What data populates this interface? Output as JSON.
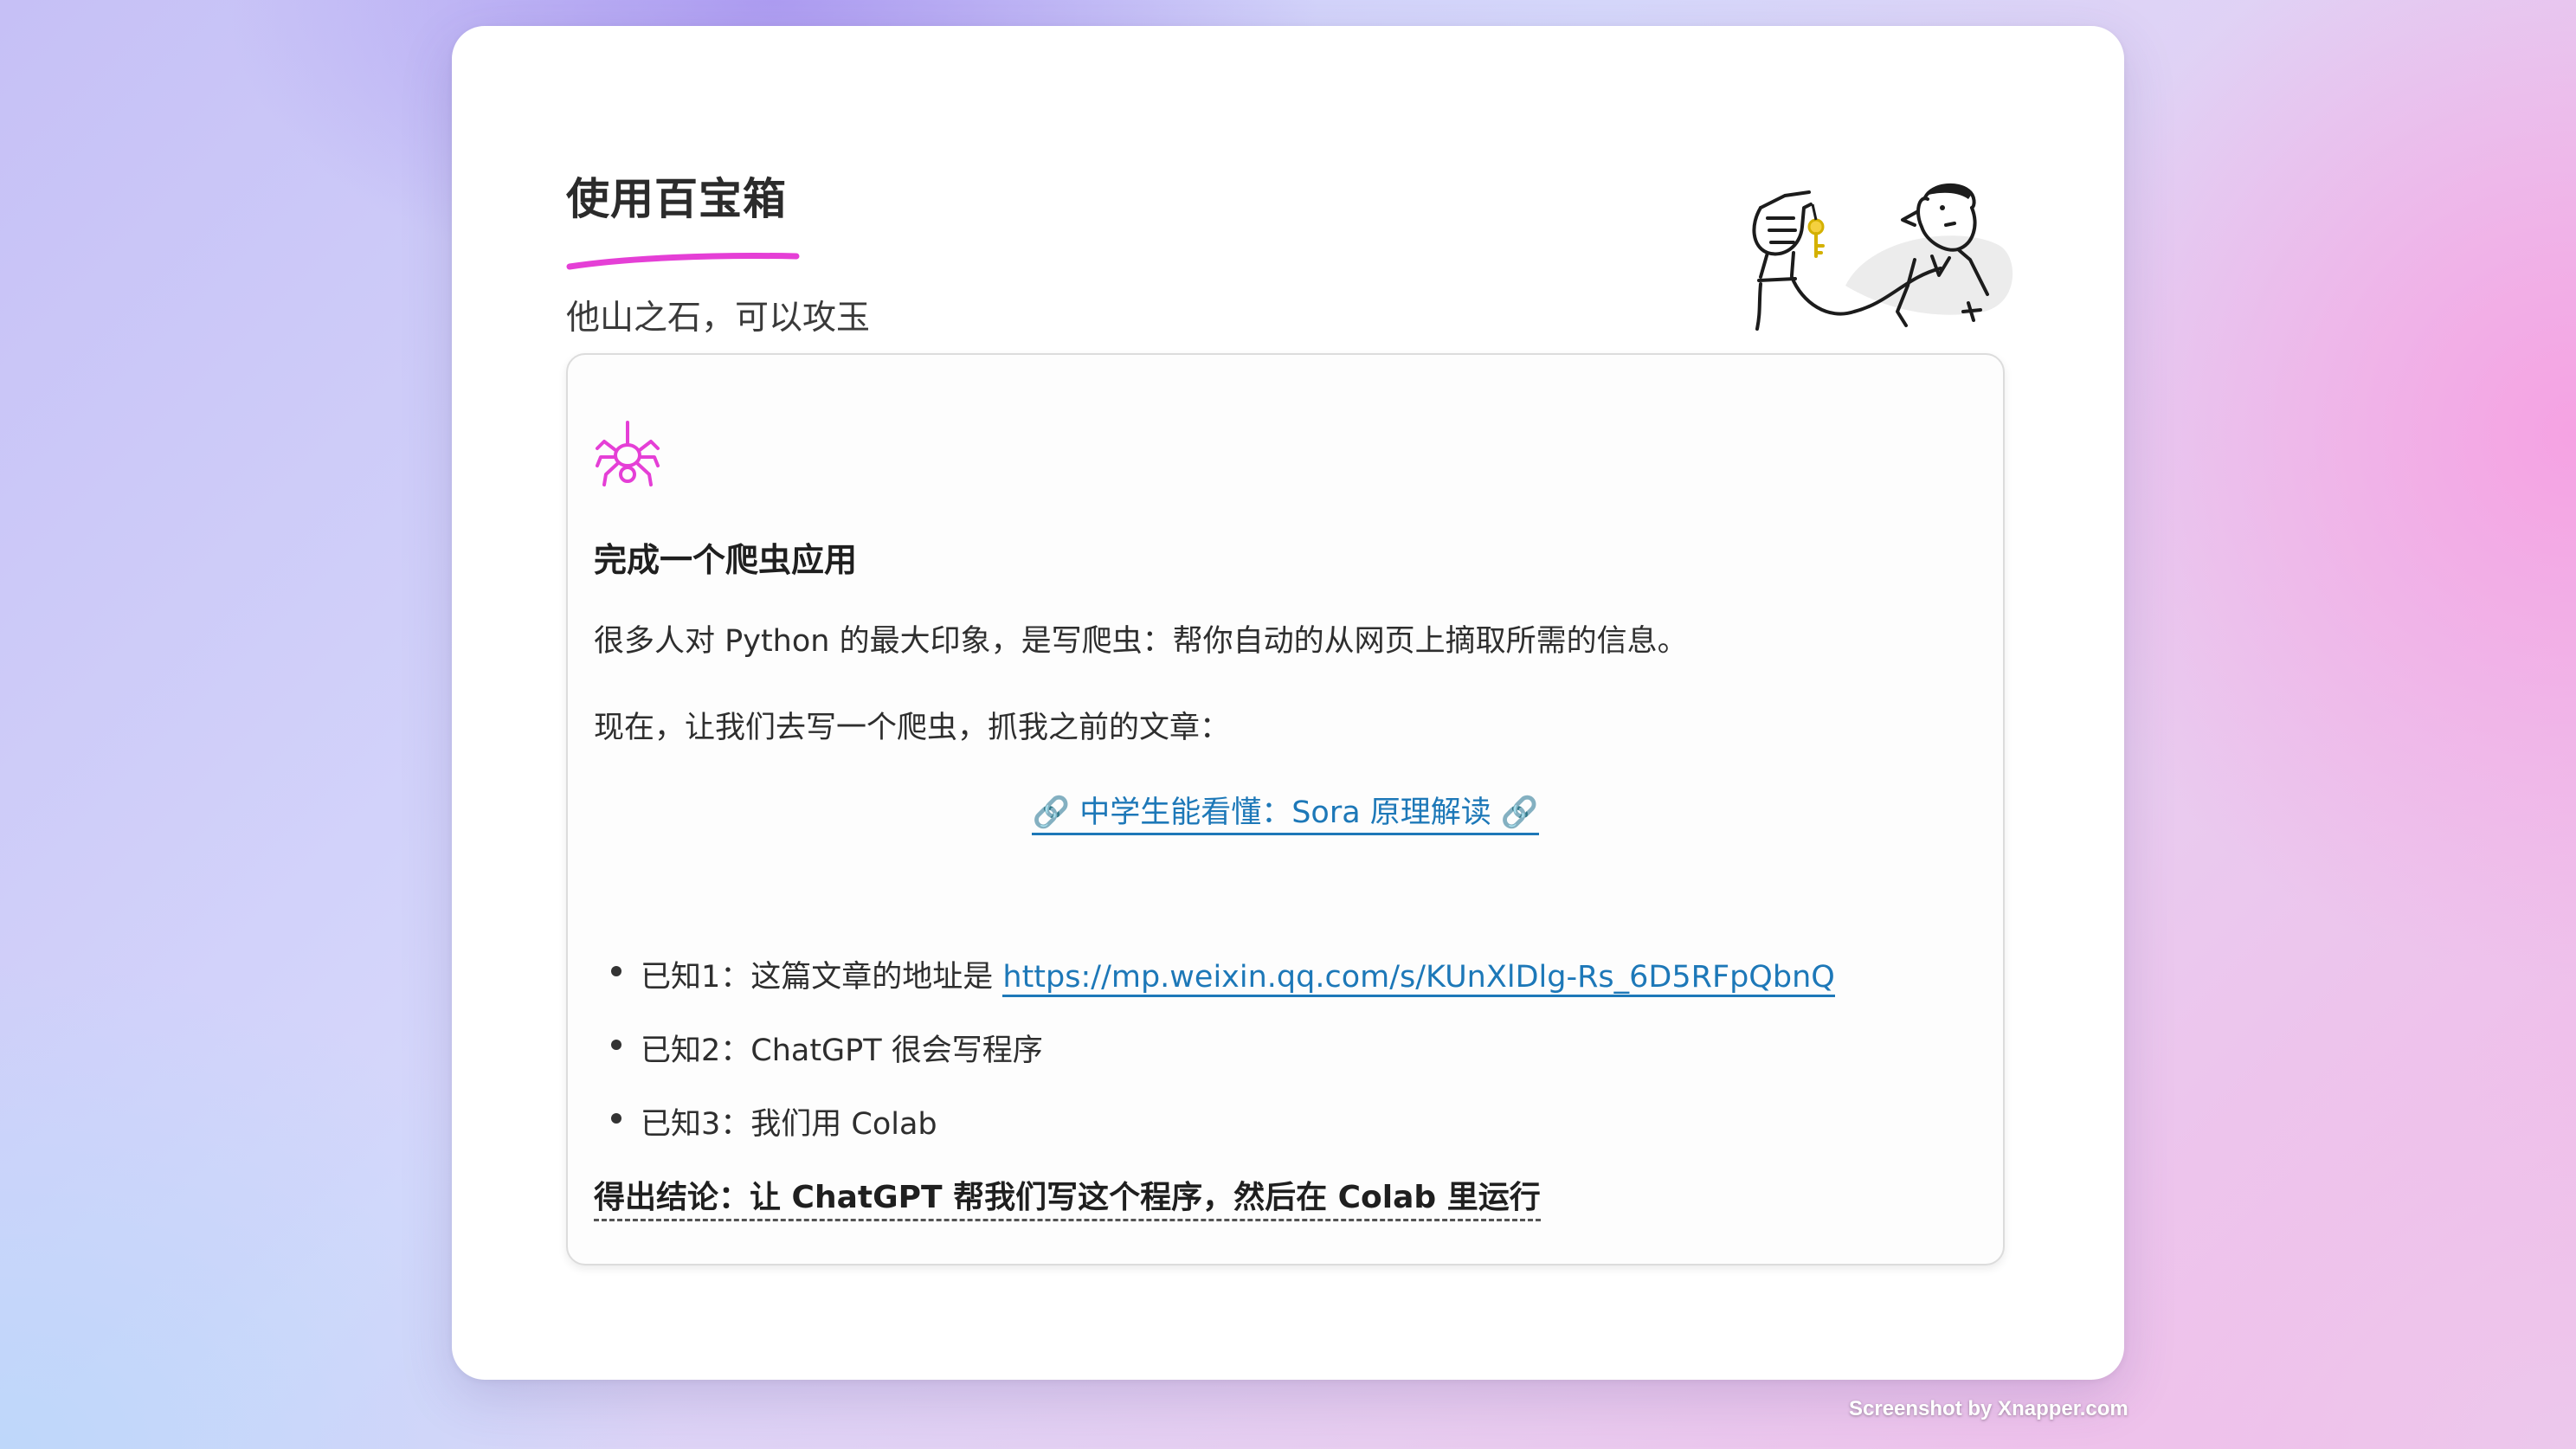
{
  "header": {
    "title": "使用百宝箱",
    "subtitle": "他山之石，可以攻玉"
  },
  "card": {
    "icon": "spider-icon",
    "heading": "完成一个爬虫应用",
    "paragraph_1": "很多人对 Python 的最大印象，是写爬虫：帮你自动的从网页上摘取所需的信息。",
    "paragraph_2": "现在，让我们去写一个爬虫，抓我之前的文章：",
    "article_link": "🔗 中学生能看懂：Sora 原理解读 🔗",
    "facts": [
      {
        "label": "已知1：这篇文章的地址是 ",
        "link": "https://mp.weixin.qq.com/s/KUnXlDlg-Rs_6D5RFpQbnQ"
      },
      {
        "label": "已知2：ChatGPT 很会写程序"
      },
      {
        "label": "已知3：我们用 Colab"
      }
    ],
    "conclusion": "得出结论：让 ChatGPT 帮我们写这个程序，然后在 Colab 里运行"
  },
  "watermark": "Screenshot by Xnapper.com",
  "colors": {
    "accent_magenta": "#e53fd6",
    "link_blue": "#1d78b8",
    "key_yellow": "#f4d03f"
  }
}
